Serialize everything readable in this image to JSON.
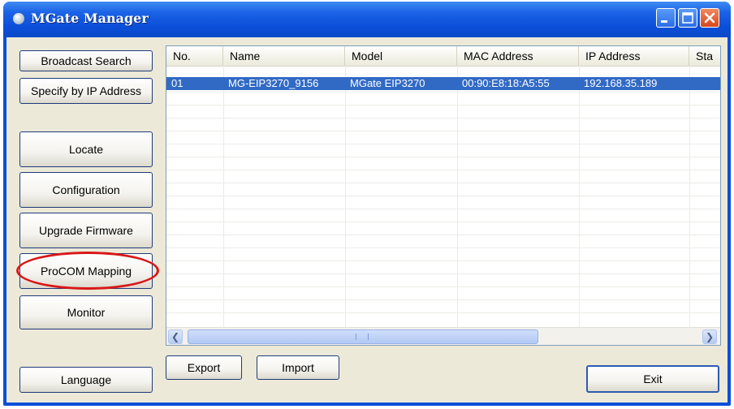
{
  "window": {
    "title": "MGate Manager"
  },
  "sidebar": {
    "broadcast_search": "Broadcast Search",
    "specify_by_ip": "Specify by IP Address",
    "locate": "Locate",
    "configuration": "Configuration",
    "upgrade_firmware": "Upgrade Firmware",
    "procom_mapping": "ProCOM Mapping",
    "monitor": "Monitor",
    "language": "Language"
  },
  "table": {
    "columns": [
      "No.",
      "Name",
      "Model",
      "MAC Address",
      "IP Address",
      "Sta"
    ],
    "rows": [
      {
        "no": "01",
        "name": "MG-EIP3270_9156",
        "model": "MGate EIP3270",
        "mac": "00:90:E8:18:A5:55",
        "ip": "192.168.35.189",
        "status": ""
      }
    ]
  },
  "bottom": {
    "export": "Export",
    "import": "Import",
    "exit": "Exit"
  },
  "colors": {
    "titlebar": "#0a4fd8",
    "selection": "#316ac5",
    "highlight_ring": "#d81818"
  },
  "icons": {
    "app": "app-icon",
    "minimize": "minimize-icon",
    "maximize": "maximize-icon",
    "close": "close-icon"
  }
}
